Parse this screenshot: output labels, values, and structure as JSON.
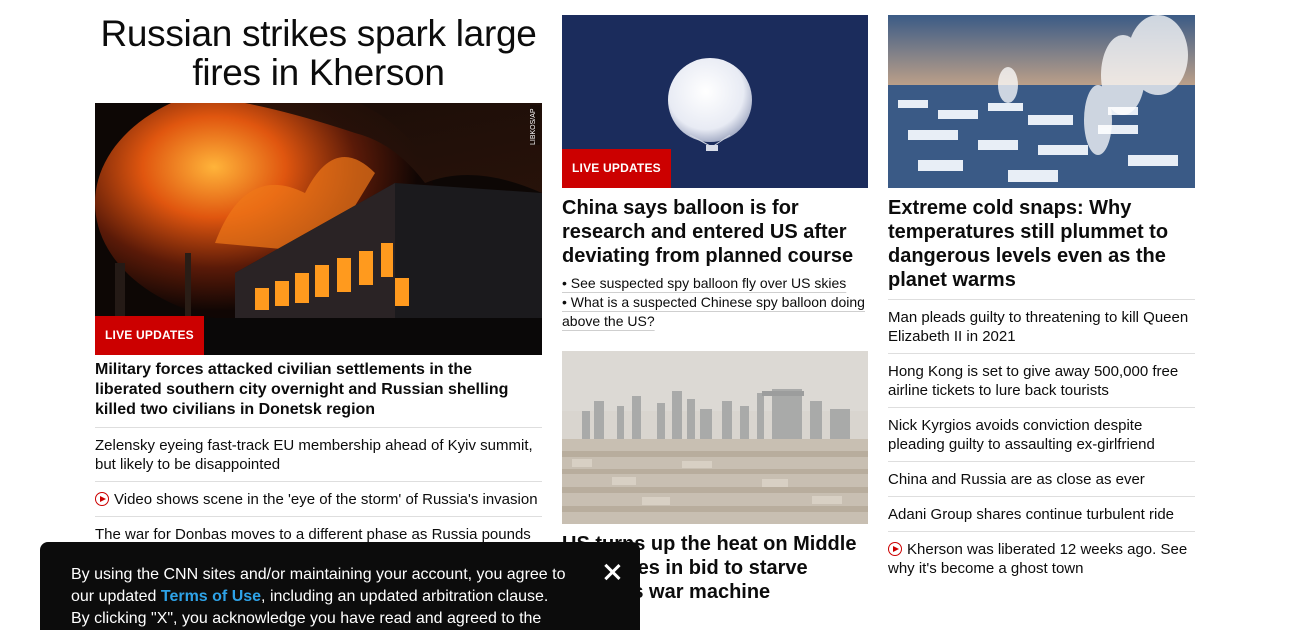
{
  "column1": {
    "headline": "Russian strikes spark large fires in Kherson",
    "image": {
      "alt": "burning-building-photo",
      "credit": "LIBKOS/AP",
      "badge": "LIVE UPDATES"
    },
    "feature_title": "Military forces attacked civilian settlements in the liberated southern city overnight and Russian shelling killed two civilians in Donetsk region",
    "items": [
      {
        "text": "Zelensky eyeing fast-track EU membership ahead of Kyiv summit, but likely to be disappointed",
        "video": false
      },
      {
        "text": "Video shows scene in the 'eye of the storm' of Russia's invasion",
        "video": true
      },
      {
        "text": "The war for Donbas moves to a different phase as Russia pounds",
        "video": false
      }
    ]
  },
  "column2": {
    "top_image": {
      "alt": "balloon-photo",
      "badge": "LIVE UPDATES"
    },
    "top_title": "China says balloon is for research and entered US after deviating from planned course",
    "bullets": [
      "• See suspected spy balloon fly over US skies",
      "• What is a suspected Chinese spy balloon doing above the US?"
    ],
    "second_image": {
      "alt": "city-skyline-photo"
    },
    "second_title": "US turns up the heat on Middle East allies in bid to starve Russia's war machine"
  },
  "column3": {
    "top_image": {
      "alt": "snowy-town-photo"
    },
    "top_title": "Extreme cold snaps: Why temperatures still plummet to dangerous levels even as the planet warms",
    "items": [
      {
        "text": "Man pleads guilty to threatening to kill Queen Elizabeth II in 2021",
        "video": false
      },
      {
        "text": "Hong Kong is set to give away 500,000 free airline tickets to lure back tourists",
        "video": false
      },
      {
        "text": "Nick Kyrgios avoids conviction despite pleading guilty to assaulting ex-girlfriend",
        "video": false
      },
      {
        "text": "China and Russia are as close as ever",
        "video": false
      },
      {
        "text": "Adani Group shares continue turbulent ride",
        "video": false
      },
      {
        "text": "Kherson was liberated 12 weeks ago. See why it's become a ghost town",
        "video": true
      }
    ]
  },
  "consent": {
    "text_before": "By using the CNN sites and/or maintaining your account, you agree to our updated ",
    "link": "Terms of Use",
    "text_after": ", including an updated arbitration clause. By clicking \"X\", you acknowledge you have read and agreed to the"
  },
  "colors": {
    "accent_red": "#cc0000",
    "link_blue": "#2ea3e8",
    "dark": "#0c0c0c"
  }
}
